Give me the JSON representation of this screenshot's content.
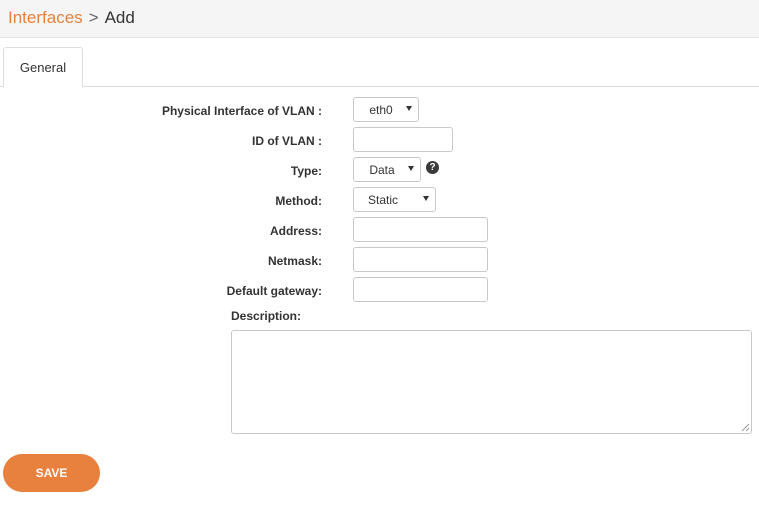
{
  "breadcrumb": {
    "parent": "Interfaces",
    "separator": ">",
    "current": "Add"
  },
  "tabs": [
    {
      "label": "General"
    }
  ],
  "form": {
    "physical_interface": {
      "label": "Physical Interface of VLAN :",
      "value": "eth0"
    },
    "vlan_id": {
      "label": "ID of VLAN :",
      "value": ""
    },
    "type": {
      "label": "Type:",
      "value": "Data"
    },
    "method": {
      "label": "Method:",
      "value": "Static"
    },
    "address": {
      "label": "Address:",
      "value": ""
    },
    "netmask": {
      "label": "Netmask:",
      "value": ""
    },
    "gateway": {
      "label": "Default gateway:",
      "value": ""
    },
    "description": {
      "label": "Description:",
      "value": ""
    }
  },
  "save_label": "SAVE",
  "colors": {
    "accent": "#e8803e",
    "header_bg": "#f5f5f5",
    "border": "#c8c8c8"
  },
  "icons": {
    "type_help": "question-circle-icon"
  }
}
